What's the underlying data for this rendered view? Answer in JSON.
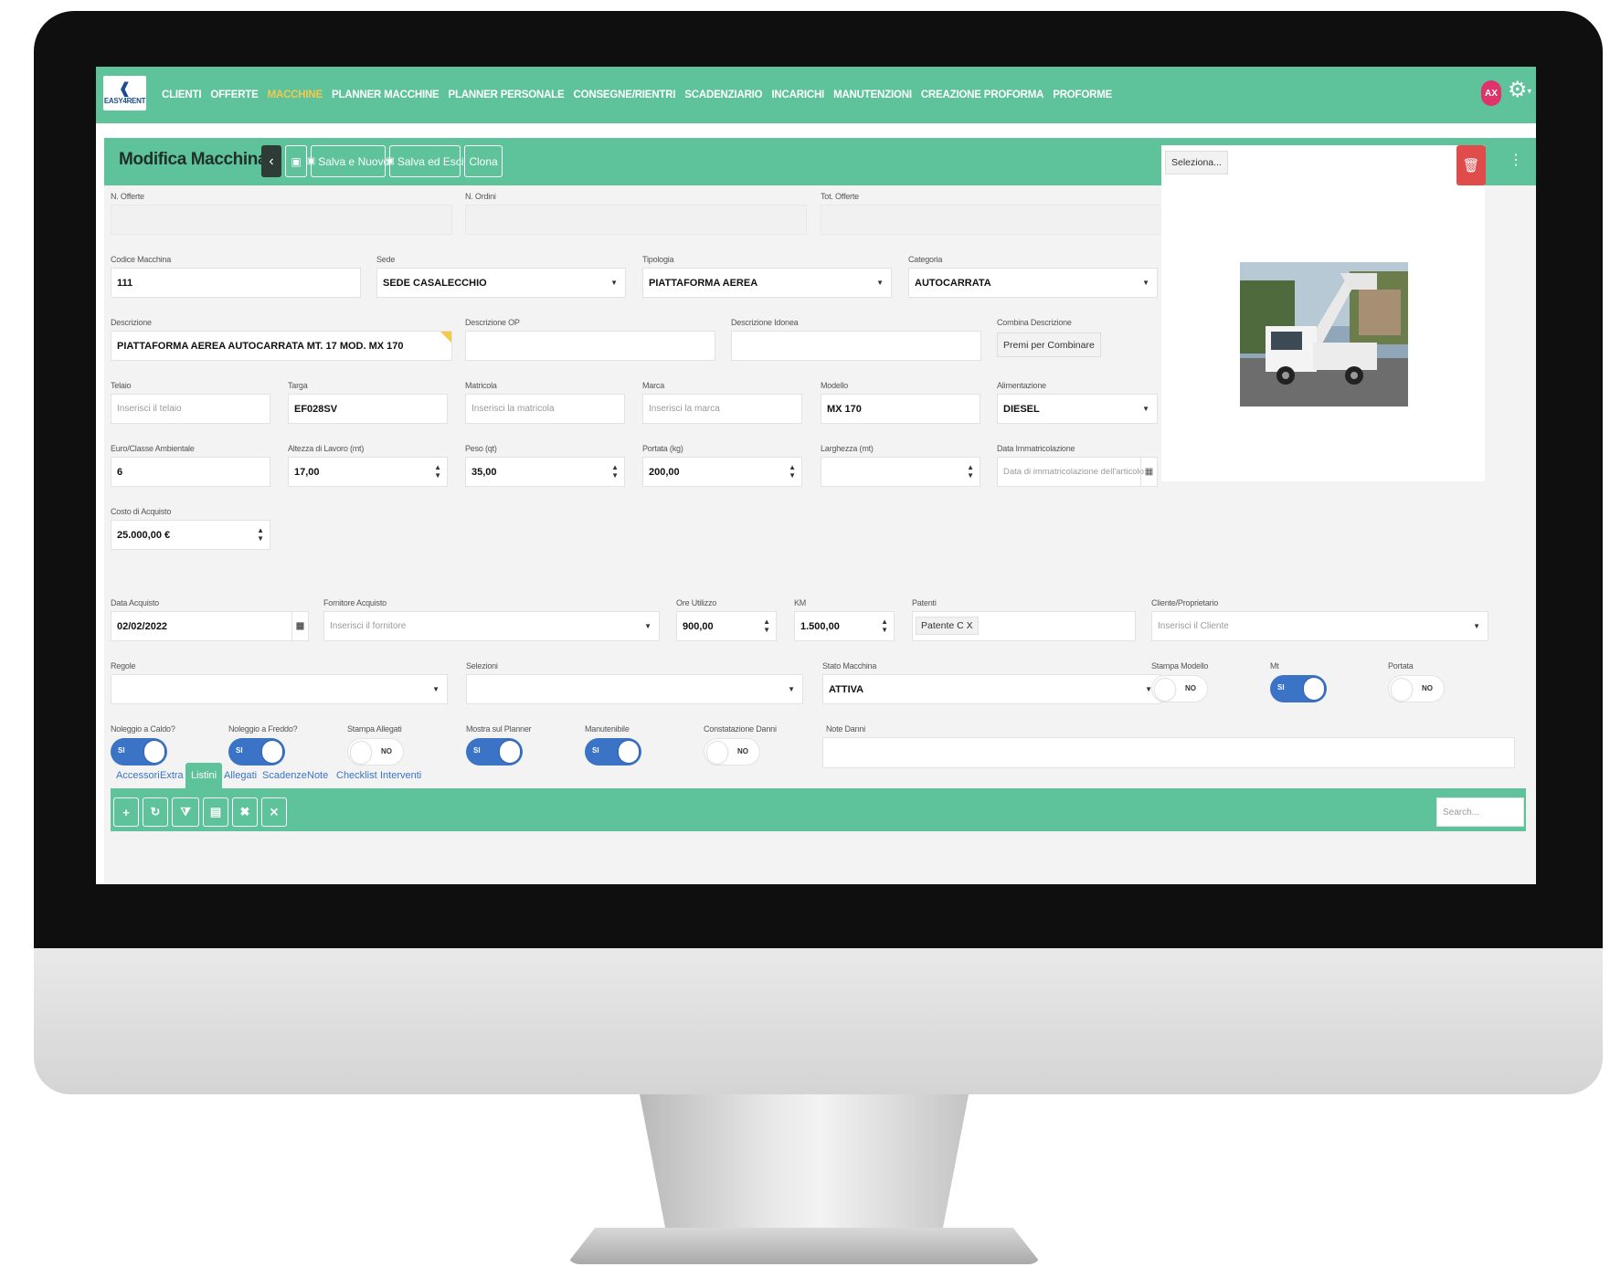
{
  "nav": {
    "brand": "EASY4RENT",
    "items": [
      {
        "label": "CLIENTI",
        "active": false
      },
      {
        "label": "OFFERTE",
        "active": false
      },
      {
        "label": "MACCHINE",
        "active": true
      },
      {
        "label": "PLANNER MACCHINE",
        "active": false
      },
      {
        "label": "PLANNER PERSONALE",
        "active": false
      },
      {
        "label": "CONSEGNE/RIENTRI",
        "active": false
      },
      {
        "label": "SCADENZIARIO",
        "active": false
      },
      {
        "label": "INCARICHI",
        "active": false
      },
      {
        "label": "MANUTENZIONI",
        "active": false
      },
      {
        "label": "CREAZIONE PROFORMA",
        "active": false
      },
      {
        "label": "PROFORME",
        "active": false
      }
    ],
    "avatar_initials": "AX",
    "settings_icon": "gear-icon",
    "colors": {
      "bar": "#5ec39b",
      "active": "#f2c94c",
      "avatar": "#e0336b"
    }
  },
  "page": {
    "title": "Modifica Macchina",
    "buttons": {
      "save_new": "Salva e Nuovo",
      "save_exit": "Salva ed Esci",
      "clone": "Clona"
    }
  },
  "form": {
    "n_offerte": {
      "label": "N. Offerte",
      "value": ""
    },
    "n_ordini": {
      "label": "N. Ordini",
      "value": ""
    },
    "tot_offerte": {
      "label": "Tot. Offerte",
      "value": ""
    },
    "codice": {
      "label": "Codice Macchina",
      "value": "111"
    },
    "sede": {
      "label": "Sede",
      "value": "SEDE CASALECCHIO"
    },
    "tipologia": {
      "label": "Tipologia",
      "value": "PIATTAFORMA AEREA"
    },
    "categoria": {
      "label": "Categoria",
      "value": "AUTOCARRATA"
    },
    "descrizione": {
      "label": "Descrizione",
      "value": "PIATTAFORMA AEREA AUTOCARRATA  MT. 17  MOD. MX 170"
    },
    "descrizione_op": {
      "label": "Descrizione OP",
      "value": ""
    },
    "descrizione_idonea": {
      "label": "Descrizione Idonea",
      "value": ""
    },
    "combina": {
      "label": "Combina Descrizione",
      "button": "Premi per Combinare"
    },
    "telaio": {
      "label": "Telaio",
      "placeholder": "Inserisci il telaio"
    },
    "targa": {
      "label": "Targa",
      "value": "EF028SV"
    },
    "matricola": {
      "label": "Matricola",
      "placeholder": "Inserisci la matricola"
    },
    "marca": {
      "label": "Marca",
      "placeholder": "Inserisci la marca"
    },
    "modello": {
      "label": "Modello",
      "value": "MX 170"
    },
    "alimentazione": {
      "label": "Alimentazione",
      "value": "DIESEL"
    },
    "euro": {
      "label": "Euro/Classe Ambientale",
      "value": "6"
    },
    "altezza": {
      "label": "Altezza di Lavoro (mt)",
      "value": "17,00"
    },
    "peso": {
      "label": "Peso (qt)",
      "value": "35,00"
    },
    "portata_kg": {
      "label": "Portata (kg)",
      "value": "200,00"
    },
    "larghezza": {
      "label": "Larghezza (mt)",
      "value": ""
    },
    "data_immatricolazione": {
      "label": "Data Immatricolazione",
      "placeholder": "Data di immatricolazione dell'articolo"
    },
    "costo": {
      "label": "Costo di Acquisto",
      "value": "25.000,00 €"
    },
    "data_acquisto": {
      "label": "Data Acquisto",
      "value": "02/02/2022"
    },
    "fornitore": {
      "label": "Fornitore Acquisto",
      "placeholder": "Inserisci il fornitore"
    },
    "ore": {
      "label": "Ore Utilizzo",
      "value": "900,00"
    },
    "km": {
      "label": "KM",
      "value": "1.500,00"
    },
    "patenti": {
      "label": "Patenti",
      "tag": "Patente C",
      "remove": "X"
    },
    "cliente": {
      "label": "Cliente/Proprietario",
      "placeholder": "Inserisci il Cliente"
    },
    "regole": {
      "label": "Regole",
      "value": ""
    },
    "selezioni": {
      "label": "Selezioni",
      "value": ""
    },
    "stato": {
      "label": "Stato Macchina",
      "value": "ATTIVA"
    },
    "note_danni": {
      "label": "Note Danni",
      "value": ""
    }
  },
  "toggles": {
    "on_text": "SI",
    "off_text": "NO",
    "stampa_modello": {
      "label": "Stampa Modello",
      "on": false
    },
    "mt": {
      "label": "Mt",
      "on": true
    },
    "portata": {
      "label": "Portata",
      "on": false
    },
    "noleggio_caldo": {
      "label": "Noleggio a Caldo?",
      "on": true
    },
    "noleggio_freddo": {
      "label": "Noleggio a Freddo?",
      "on": true
    },
    "stampa_allegati": {
      "label": "Stampa Allegati",
      "on": false
    },
    "mostra_planner": {
      "label": "Mostra sul Planner",
      "on": true
    },
    "manutenibile": {
      "label": "Manutenibile",
      "on": true
    },
    "constatazione": {
      "label": "Constatazione Danni",
      "on": false
    }
  },
  "image_panel": {
    "select_button": "Seleziona...",
    "delete_icon": "trash-icon",
    "photo": "white truck with aerial work platform"
  },
  "tabs": [
    {
      "label": "Accessori",
      "active": false
    },
    {
      "label": "Extra",
      "active": false
    },
    {
      "label": "Listini",
      "active": true
    },
    {
      "label": "Allegati",
      "active": false
    },
    {
      "label": "Scadenze",
      "active": false
    },
    {
      "label": "Note",
      "active": false
    },
    {
      "label": "Checklist",
      "active": false
    },
    {
      "label": "Interventi",
      "active": false
    }
  ],
  "grid_toolbar": {
    "icons": [
      "plus-icon",
      "refresh-icon",
      "clear-filter-icon",
      "export-icon",
      "expand-icon",
      "collapse-icon"
    ],
    "search_placeholder": "Search..."
  }
}
